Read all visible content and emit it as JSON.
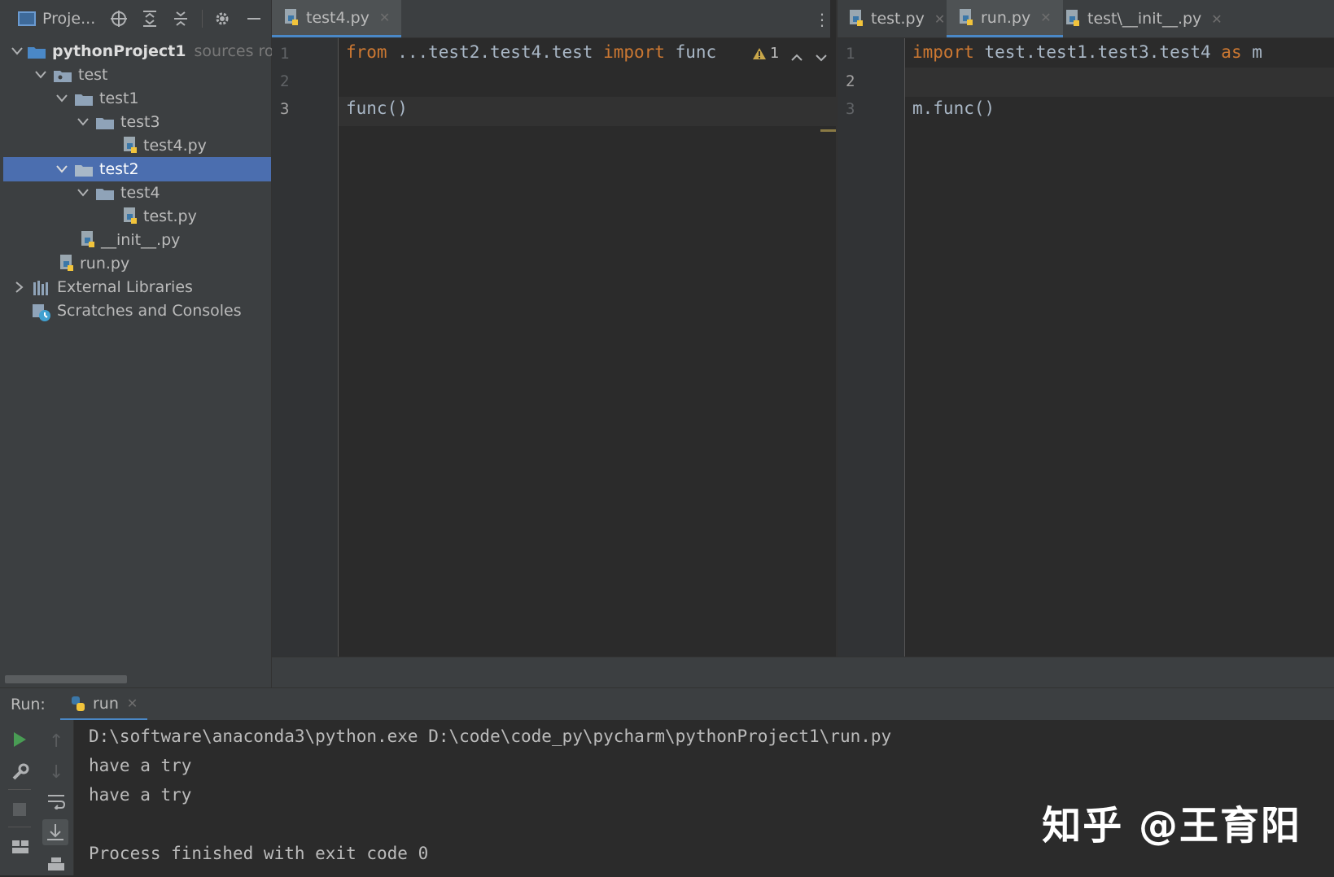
{
  "project_panel": {
    "title": "Proje...",
    "tree": [
      {
        "label": "pythonProject1",
        "suffix": "sources root,",
        "type": "folder",
        "expanded": true
      },
      {
        "label": "test",
        "type": "folder",
        "expanded": true
      },
      {
        "label": "test1",
        "type": "folder",
        "expanded": true
      },
      {
        "label": "test3",
        "type": "folder",
        "expanded": true
      },
      {
        "label": "test4.py",
        "type": "py"
      },
      {
        "label": "test2",
        "type": "folder",
        "expanded": true,
        "selected": true
      },
      {
        "label": "test4",
        "type": "folder",
        "expanded": true
      },
      {
        "label": "test.py",
        "type": "py"
      },
      {
        "label": "__init__.py",
        "type": "py"
      },
      {
        "label": "run.py",
        "type": "py"
      },
      {
        "label": "External Libraries",
        "type": "lib",
        "expanded": false
      },
      {
        "label": "Scratches and Consoles",
        "type": "scratch"
      }
    ]
  },
  "left_editor": {
    "tabs": [
      {
        "label": "test4.py",
        "active": true
      }
    ],
    "lines": [
      {
        "no": "1",
        "segments": [
          {
            "t": "from",
            "kw": true
          },
          {
            "t": " ...test2.test4.test "
          },
          {
            "t": "import",
            "kw": true
          },
          {
            "t": " func"
          }
        ]
      },
      {
        "no": "2",
        "segments": []
      },
      {
        "no": "3",
        "segments": [
          {
            "t": "func()"
          }
        ]
      }
    ],
    "warning_count": "1"
  },
  "right_editor": {
    "tabs": [
      {
        "label": "test.py",
        "active": false
      },
      {
        "label": "run.py",
        "active": true
      },
      {
        "label": "test\\__init__.py",
        "active": false
      }
    ],
    "lines": [
      {
        "no": "1",
        "segments": [
          {
            "t": "import",
            "kw": true
          },
          {
            "t": " test.test1.test3.test4 "
          },
          {
            "t": "as",
            "kw": true
          },
          {
            "t": " m"
          }
        ]
      },
      {
        "no": "2",
        "segments": []
      },
      {
        "no": "3",
        "segments": [
          {
            "t": "m.func()"
          }
        ]
      }
    ]
  },
  "run_panel": {
    "label": "Run:",
    "tab": "run",
    "output": [
      "D:\\software\\anaconda3\\python.exe D:\\code\\code_py\\pycharm\\pythonProject1\\run.py",
      "have a try",
      "have a try",
      "",
      "Process finished with exit code 0"
    ]
  },
  "watermark": "知乎 @王育阳",
  "colors": {
    "keyword": "#cc7832",
    "code": "#a9b7c6",
    "selection": "#4b6eaf",
    "folder": "#8fa3b8",
    "run_green": "#499c54"
  }
}
